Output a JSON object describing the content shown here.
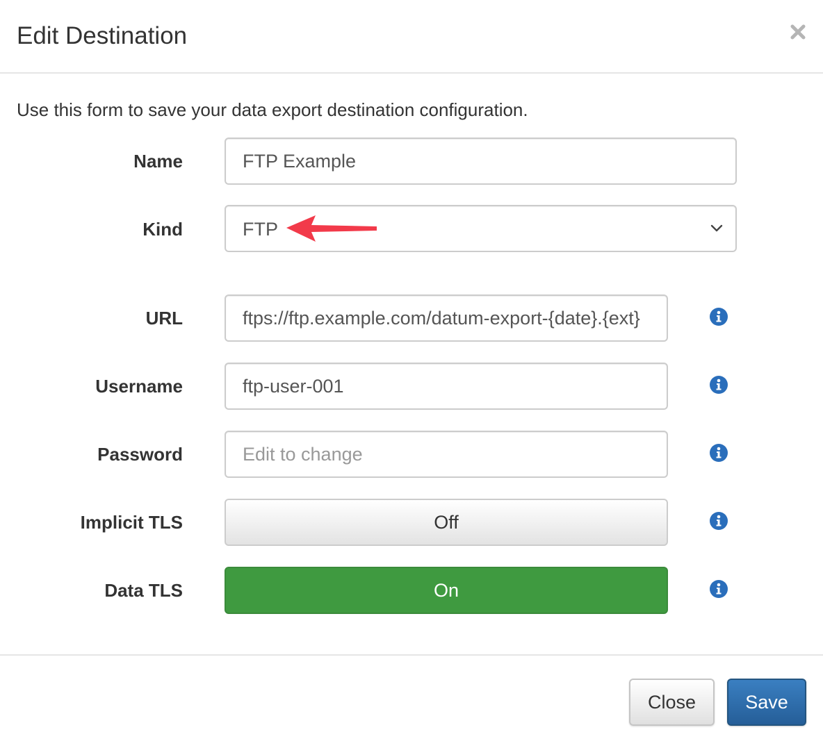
{
  "dialog": {
    "title": "Edit Destination",
    "intro": "Use this form to save your data export destination configuration."
  },
  "fields": {
    "name": {
      "label": "Name",
      "value": "FTP Example"
    },
    "kind": {
      "label": "Kind",
      "value": "FTP"
    },
    "url": {
      "label": "URL",
      "value": "ftps://ftp.example.com/datum-export-{date}.{ext}"
    },
    "username": {
      "label": "Username",
      "value": "ftp-user-001"
    },
    "password": {
      "label": "Password",
      "placeholder": "Edit to change"
    },
    "implicit_tls": {
      "label": "Implicit TLS",
      "value": "Off"
    },
    "data_tls": {
      "label": "Data TLS",
      "value": "On"
    }
  },
  "footer": {
    "close_label": "Close",
    "save_label": "Save"
  },
  "colors": {
    "primary": "#2a6ebb",
    "success": "#3f9a40",
    "info_icon": "#2a6ebb",
    "annotation_arrow": "#f23a4a"
  },
  "icons": {
    "close": "close-icon",
    "info": "info-icon",
    "chevron": "chevron-down-icon",
    "annotation": "arrow-left-annotation"
  }
}
